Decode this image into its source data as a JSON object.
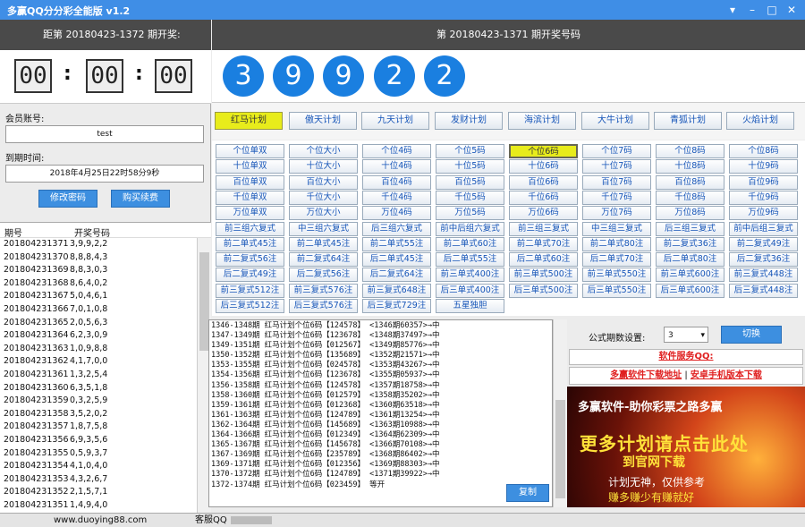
{
  "window": {
    "title": "多赢QQ分分彩全能版 v1.2"
  },
  "countdown": {
    "label": "距第 20180423-1372 期开奖:",
    "hours": "00",
    "minutes": "00",
    "seconds": "00"
  },
  "draw": {
    "label": "第 20180423-1371 期开奖号码",
    "numbers": [
      "3",
      "9",
      "9",
      "2",
      "2"
    ]
  },
  "account": {
    "label": "会员账号:",
    "value": "test",
    "expiry_label": "到期时间:",
    "expiry": "2018年4月25日22时58分9秒",
    "change_pwd": "修改密码",
    "buy": "购买续费"
  },
  "history": {
    "col_period": "期号",
    "col_numbers": "开奖号码",
    "rows": [
      [
        "201804231371",
        "3,9,9,2,2"
      ],
      [
        "201804231370",
        "8,8,8,4,3"
      ],
      [
        "201804231369",
        "8,8,3,0,3"
      ],
      [
        "201804231368",
        "8,6,4,0,2"
      ],
      [
        "201804231367",
        "5,0,4,6,1"
      ],
      [
        "201804231366",
        "7,0,1,0,8"
      ],
      [
        "201804231365",
        "2,0,5,6,3"
      ],
      [
        "201804231364",
        "6,2,3,0,9"
      ],
      [
        "201804231363",
        "1,0,9,8,8"
      ],
      [
        "201804231362",
        "4,1,7,0,0"
      ],
      [
        "201804231361",
        "1,3,2,5,4"
      ],
      [
        "201804231360",
        "6,3,5,1,8"
      ],
      [
        "201804231359",
        "0,3,2,5,9"
      ],
      [
        "201804231358",
        "3,5,2,0,2"
      ],
      [
        "201804231357",
        "1,8,7,5,8"
      ],
      [
        "201804231356",
        "6,9,3,5,6"
      ],
      [
        "201804231355",
        "0,5,9,3,7"
      ],
      [
        "201804231354",
        "4,1,0,4,0"
      ],
      [
        "201804231353",
        "4,3,2,6,7"
      ],
      [
        "201804231352",
        "2,1,5,7,1"
      ],
      [
        "201804231351",
        "1,4,9,4,0"
      ]
    ]
  },
  "plans": [
    "红马计划",
    "傲天计划",
    "九天计划",
    "发财计划",
    "海滨计划",
    "大牛计划",
    "青狐计划",
    "火焰计划"
  ],
  "grid": [
    [
      "个位单双",
      "个位大小",
      "个位4码",
      "个位5码",
      "个位6码",
      "个位7码",
      "个位8码",
      "个位8码"
    ],
    [
      "十位单双",
      "十位大小",
      "十位4码",
      "十位5码",
      "十位6码",
      "十位7码",
      "十位8码",
      "十位9码"
    ],
    [
      "百位单双",
      "百位大小",
      "百位4码",
      "百位5码",
      "百位6码",
      "百位7码",
      "百位8码",
      "百位9码"
    ],
    [
      "千位单双",
      "千位大小",
      "千位4码",
      "千位5码",
      "千位6码",
      "千位7码",
      "千位8码",
      "千位9码"
    ],
    [
      "万位单双",
      "万位大小",
      "万位4码",
      "万位5码",
      "万位6码",
      "万位7码",
      "万位8码",
      "万位9码"
    ],
    [
      "前三组六复式",
      "中三组六复式",
      "后三组六复式",
      "前中后组六复式",
      "前三组三复式",
      "中三组三复式",
      "后三组三复式",
      "前中后组三复式"
    ],
    [
      "前二单式45注",
      "前二单式45注",
      "前二单式55注",
      "前二单式60注",
      "前二单式70注",
      "前二单式80注",
      "前二复式36注",
      "前二复式49注"
    ],
    [
      "前二复式56注",
      "前二复式64注",
      "后二单式45注",
      "后二单式55注",
      "后二单式60注",
      "后二单式70注",
      "后二单式80注",
      "后二复式36注"
    ],
    [
      "后二复式49注",
      "后二复式56注",
      "后二复式64注",
      "前三单式400注",
      "前三单式500注",
      "前三单式550注",
      "前三单式600注",
      "前三复式448注"
    ],
    [
      "前三复式512注",
      "前三复式576注",
      "前三复式648注",
      "后三单式400注",
      "后三单式500注",
      "后三单式550注",
      "后三单式600注",
      "后三复式448注"
    ],
    [
      "后三复式512注",
      "后三复式576注",
      "后三复式729注",
      "五星独胆",
      "",
      "",
      "",
      ""
    ]
  ],
  "log": [
    "1346-1348期 红马计划个位6码【124578】 <1346期60357>→中",
    "1347-1349期 红马计划个位6码【123678】 <1348期37497>→中",
    "1349-1351期 红马计划个位6码【012567】 <1349期85776>→中",
    "1350-1352期 红马计划个位6码【135689】 <1352期21571>→中",
    "1353-1355期 红马计划个位6码【024578】 <1353期43267>→中",
    "1354-1356期 红马计划个位6码【123678】 <1355期05937>→中",
    "1356-1358期 红马计划个位6码【124578】 <1357期18758>→中",
    "1358-1360期 红马计划个位6码【012579】 <1358期35202>→中",
    "1359-1361期 红马计划个位6码【012368】 <1360期63518>→中",
    "1361-1363期 红马计划个位6码【124789】 <1361期13254>→中",
    "1362-1364期 红马计划个位6码【145689】 <1363期10988>→中",
    "1364-1366期 红马计划个位6码【012349】 <1364期62309>→中",
    "1365-1367期 红马计划个位6码【145678】 <1366期70108>→中",
    "1367-1369期 红马计划个位6码【235789】 <1368期86402>→中",
    "1369-1371期 红马计划个位6码【012356】 <1369期88303>→中",
    "1370-1372期 红马计划个位6码【124789】 <1371期39922>→中",
    "1372-1374期 红马计划个位6码【023459】 等开"
  ],
  "copy": "复制",
  "settings": {
    "label": "公式期数设置:",
    "value": "3",
    "switch": "切换"
  },
  "service": {
    "label": "软件服务QQ:",
    "download": "多赢软件下载地址",
    "sep": "|",
    "android": "安卓手机版本下载"
  },
  "ad": {
    "line1": "多赢软件-助你彩票之路多赢",
    "line2": "更多计划请点击此处",
    "line3": "到官网下载",
    "line4": "计划无神，仅供参考",
    "line5": "赚多赚少有赚就好"
  },
  "status": {
    "left": "www.duoying88.com",
    "right": "客服QQ"
  }
}
